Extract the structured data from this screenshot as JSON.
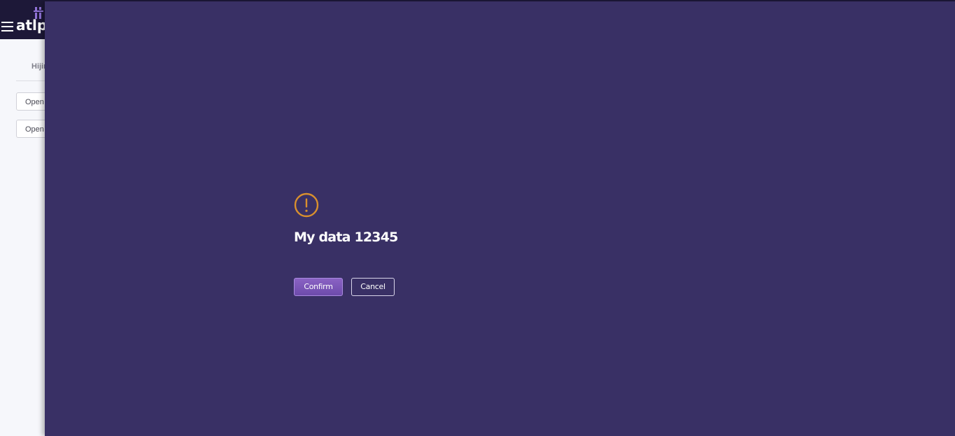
{
  "app": {
    "logo_text": "atlp",
    "tab_label": "Hijir",
    "open_buttons": [
      {
        "label": "Open"
      },
      {
        "label": "Open"
      }
    ]
  },
  "dialog": {
    "icon": "exclamation-circle-icon",
    "title": "My data 12345",
    "confirm_label": "Confirm",
    "cancel_label": "Cancel"
  },
  "colors": {
    "overlay_bg": "#393065",
    "warning_icon": "#d9902e",
    "top_bar": "#1d1838",
    "confirm_button": "#7a56b8"
  }
}
